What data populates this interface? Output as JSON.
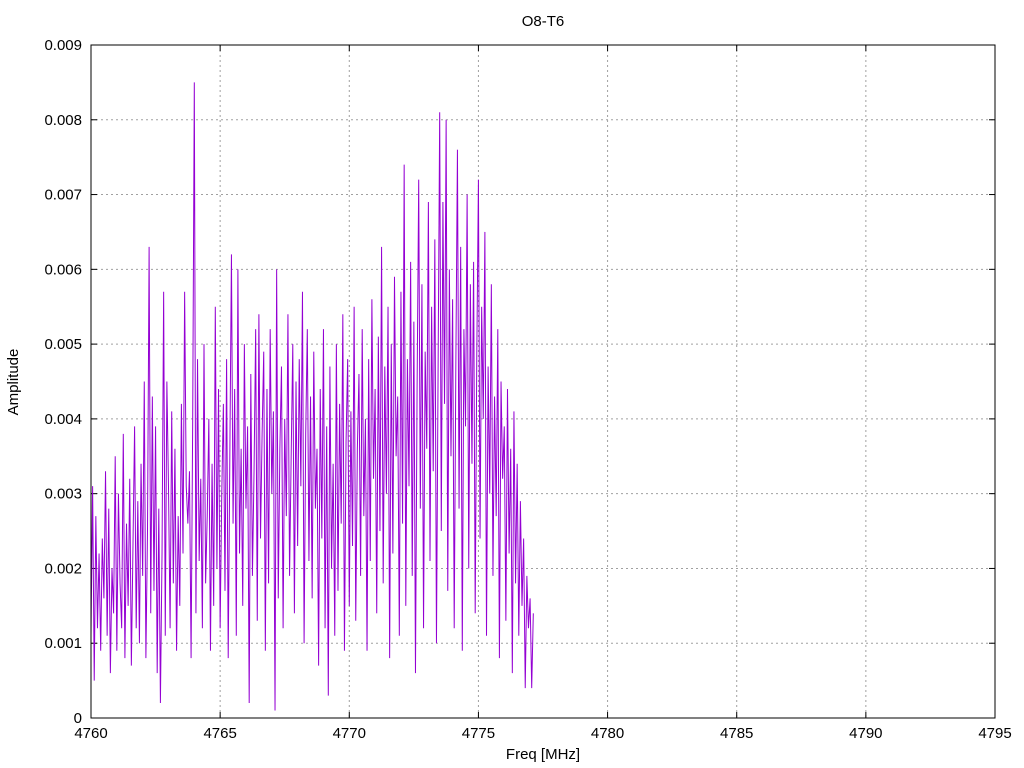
{
  "chart_data": {
    "type": "line",
    "title": "O8-T6",
    "xlabel": "Freq [MHz]",
    "ylabel": "Amplitude",
    "xlim": [
      4760,
      4795
    ],
    "ylim": [
      0,
      0.009
    ],
    "grid": true,
    "x_ticks": [
      "4760",
      "4765",
      "4770",
      "4775",
      "4780",
      "4785",
      "4790",
      "4795"
    ],
    "y_ticks": [
      "0",
      "0.001",
      "0.002",
      "0.003",
      "0.004",
      "0.005",
      "0.006",
      "0.007",
      "0.008",
      "0.009"
    ],
    "series": [
      {
        "color": "#9400d3",
        "x_start": 4760,
        "x_step": 0.0625,
        "values": [
          0.0011,
          0.0031,
          0.0005,
          0.0027,
          0.0012,
          0.0022,
          0.0009,
          0.0024,
          0.0016,
          0.0033,
          0.0011,
          0.0028,
          0.0006,
          0.002,
          0.0014,
          0.0035,
          0.0009,
          0.003,
          0.0018,
          0.0012,
          0.0038,
          0.0008,
          0.0026,
          0.0015,
          0.0032,
          0.0007,
          0.0023,
          0.0039,
          0.0012,
          0.0029,
          0.001,
          0.0034,
          0.0019,
          0.0045,
          0.0008,
          0.0025,
          0.0063,
          0.0014,
          0.0043,
          0.0017,
          0.0039,
          0.0006,
          0.0028,
          0.0002,
          0.0022,
          0.0057,
          0.0011,
          0.0045,
          0.0031,
          0.0012,
          0.0041,
          0.0018,
          0.0036,
          0.0009,
          0.0027,
          0.0015,
          0.0042,
          0.0022,
          0.0057,
          0.0031,
          0.0026,
          0.0033,
          0.0008,
          0.004,
          0.0085,
          0.0014,
          0.0048,
          0.0021,
          0.0032,
          0.0012,
          0.005,
          0.0018,
          0.0027,
          0.004,
          0.0009,
          0.0034,
          0.0015,
          0.0055,
          0.002,
          0.0044,
          0.0012,
          0.003,
          0.0042,
          0.0017,
          0.0048,
          0.0008,
          0.0035,
          0.0062,
          0.0026,
          0.0044,
          0.0011,
          0.006,
          0.0022,
          0.0036,
          0.0015,
          0.005,
          0.0028,
          0.0039,
          0.0002,
          0.0046,
          0.0019,
          0.0033,
          0.0052,
          0.0013,
          0.0054,
          0.0024,
          0.0038,
          0.0049,
          0.0009,
          0.0044,
          0.0018,
          0.0052,
          0.003,
          0.0041,
          0.0001,
          0.006,
          0.0016,
          0.0036,
          0.0047,
          0.0012,
          0.004,
          0.0027,
          0.0054,
          0.0019,
          0.0035,
          0.005,
          0.0014,
          0.0045,
          0.0023,
          0.0048,
          0.0031,
          0.0057,
          0.001,
          0.0038,
          0.0052,
          0.0021,
          0.0043,
          0.0016,
          0.0049,
          0.0028,
          0.0036,
          0.0007,
          0.0044,
          0.0024,
          0.0052,
          0.0012,
          0.0039,
          0.0003,
          0.0047,
          0.002,
          0.0034,
          0.0011,
          0.005,
          0.0017,
          0.0042,
          0.0026,
          0.0054,
          0.0009,
          0.0037,
          0.0048,
          0.0015,
          0.0041,
          0.0023,
          0.0055,
          0.0013,
          0.0036,
          0.0046,
          0.0019,
          0.0052,
          0.0027,
          0.004,
          0.0009,
          0.0048,
          0.0021,
          0.0056,
          0.0032,
          0.0044,
          0.0014,
          0.0051,
          0.0025,
          0.0063,
          0.0018,
          0.0047,
          0.003,
          0.0055,
          0.0008,
          0.005,
          0.0022,
          0.0059,
          0.0035,
          0.0043,
          0.0011,
          0.0057,
          0.0026,
          0.0074,
          0.0015,
          0.0048,
          0.0031,
          0.0061,
          0.0019,
          0.0053,
          0.0006,
          0.0044,
          0.0072,
          0.0028,
          0.0058,
          0.0012,
          0.0049,
          0.0036,
          0.0069,
          0.0021,
          0.0055,
          0.0033,
          0.0064,
          0.001,
          0.0046,
          0.0081,
          0.0025,
          0.0069,
          0.0042,
          0.008,
          0.0017,
          0.006,
          0.0035,
          0.0056,
          0.0012,
          0.0047,
          0.0076,
          0.0028,
          0.0063,
          0.0009,
          0.0052,
          0.0039,
          0.007,
          0.002,
          0.0058,
          0.0034,
          0.0061,
          0.0014,
          0.0049,
          0.0072,
          0.0024,
          0.0055,
          0.004,
          0.0065,
          0.0011,
          0.0047,
          0.003,
          0.0058,
          0.0019,
          0.0043,
          0.0027,
          0.0052,
          0.0008,
          0.0045,
          0.0032,
          0.0039,
          0.0013,
          0.0044,
          0.0022,
          0.0036,
          0.0006,
          0.0041,
          0.0018,
          0.0034,
          0.0011,
          0.0029,
          0.0015,
          0.0024,
          0.0004,
          0.0019,
          0.0012,
          0.0016,
          0.0004,
          0.0014
        ]
      }
    ]
  }
}
